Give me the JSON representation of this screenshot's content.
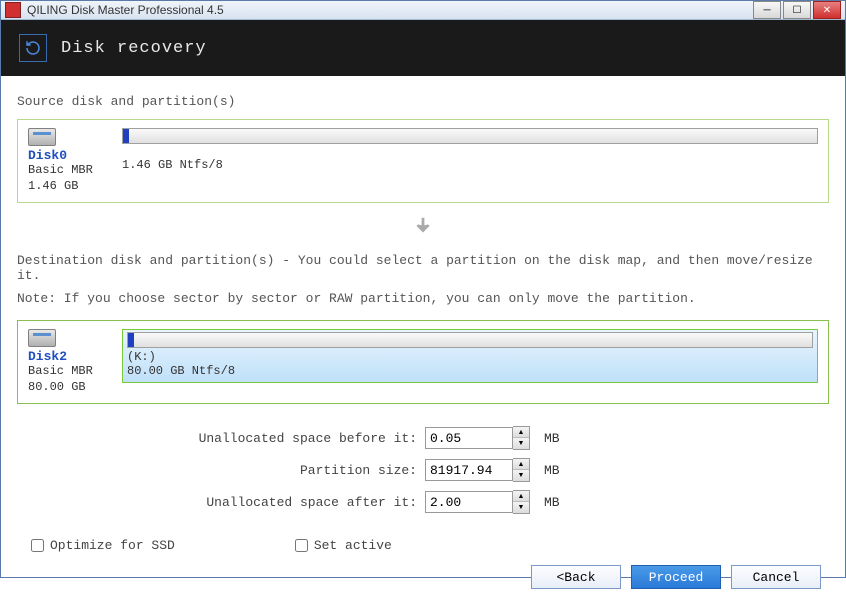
{
  "window": {
    "title": "QILING Disk Master Professional 4.5"
  },
  "header": {
    "title": "Disk recovery"
  },
  "source": {
    "label": "Source disk and partition(s)",
    "disk": {
      "name": "Disk0",
      "type": "Basic MBR",
      "size": "1.46 GB",
      "bar_label": "1.46 GB Ntfs/8"
    }
  },
  "dest": {
    "label": "Destination disk and partition(s) - You could select a partition on the disk map, and then move/resize it.",
    "note": "Note: If you choose sector by sector or RAW partition, you can only move the partition.",
    "disk": {
      "name": "Disk2",
      "type": "Basic MBR",
      "size": "80.00 GB",
      "letter": "(K:)",
      "bar_label": "80.00 GB Ntfs/8"
    }
  },
  "params": {
    "before_label": "Unallocated space before it:",
    "before_value": "0.05",
    "size_label": "Partition size:",
    "size_value": "81917.94",
    "after_label": "Unallocated space after it:",
    "after_value": "2.00",
    "unit": "MB"
  },
  "options": {
    "ssd": "Optimize for SSD",
    "active": "Set active"
  },
  "buttons": {
    "back": "<Back",
    "proceed": "Proceed",
    "cancel": "Cancel"
  }
}
